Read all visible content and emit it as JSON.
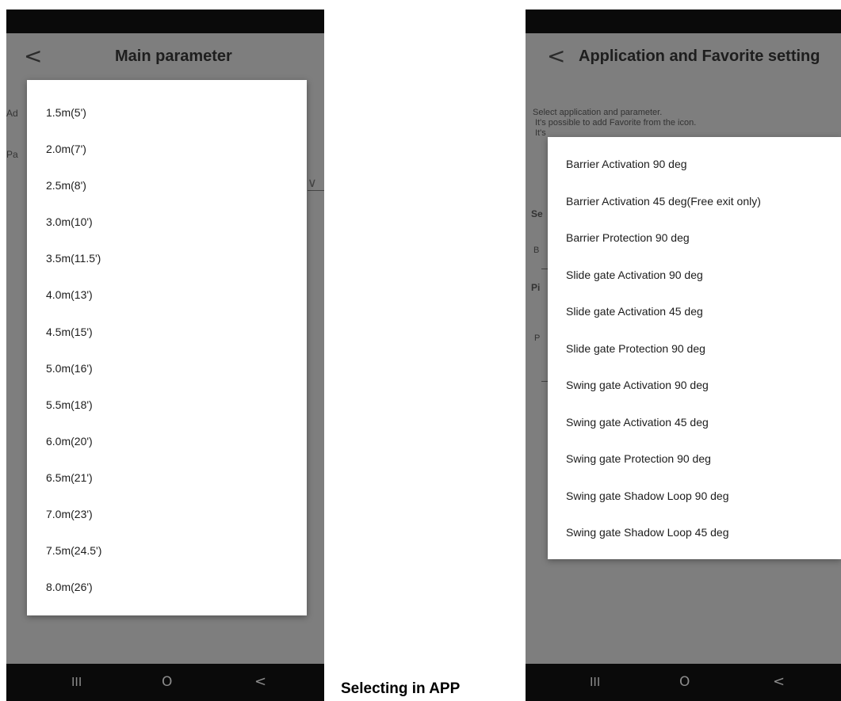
{
  "left_screen": {
    "header": {
      "back_icon": "chevron-left-icon",
      "back_glyph": "<",
      "title": "Main parameter"
    },
    "background_fragments": [
      "Ad",
      "Pa"
    ],
    "dropdown_icon": "chevron-down-icon",
    "dropdown_glyph": "∨",
    "options": [
      "1.5m(5')",
      "2.0m(7')",
      "2.5m(8')",
      "3.0m(10')",
      "3.5m(11.5')",
      "4.0m(13')",
      "4.5m(15')",
      "5.0m(16')",
      "5.5m(18')",
      "6.0m(20')",
      "6.5m(21')",
      "7.0m(23')",
      "7.5m(24.5')",
      "8.0m(26')"
    ],
    "nav": {
      "recents_glyph": "III",
      "home_glyph": "O",
      "back_glyph": "<"
    }
  },
  "right_screen": {
    "header": {
      "back_icon": "chevron-left-icon",
      "back_glyph": "<",
      "title": "Application and Favorite setting"
    },
    "background_text": {
      "line1": "Select application and parameter.",
      "line2": "It's possible to add Favorite from the icon.",
      "line3": "It's",
      "label_se": "Se",
      "label_b": "B",
      "label_pi": "Pi",
      "label_p": "P"
    },
    "options": [
      "Barrier Activation 90 deg",
      "Barrier Activation 45 deg(Free exit only)",
      "Barrier Protection 90 deg",
      "Slide gate Activation 90 deg",
      "Slide gate Activation 45 deg",
      "Slide gate Protection 90 deg",
      "Swing gate Activation 90 deg",
      "Swing gate Activation 45 deg",
      "Swing gate Protection 90 deg",
      "Swing gate Shadow Loop 90 deg",
      "Swing gate Shadow Loop 45 deg"
    ],
    "nav": {
      "recents_glyph": "III",
      "home_glyph": "O",
      "back_glyph": "<"
    }
  },
  "caption": "Selecting in APP",
  "colors": {
    "dim_background": "#7e7e7e",
    "system_bar": "#0a0a0a",
    "dialog": "#ffffff"
  }
}
